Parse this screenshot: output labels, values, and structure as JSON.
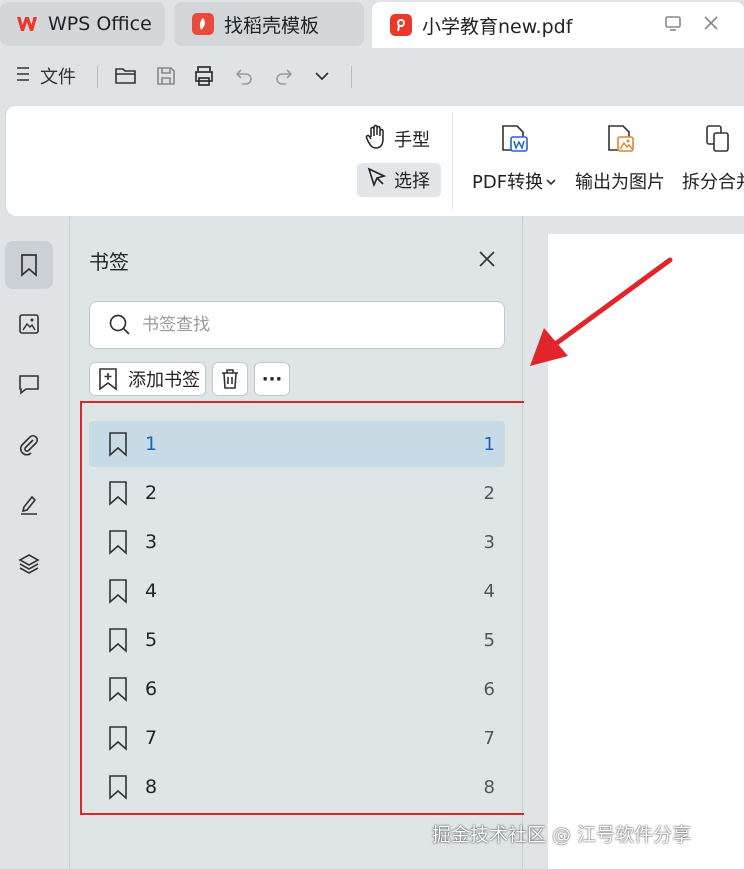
{
  "tabs": [
    {
      "label": "WPS Office"
    },
    {
      "label": "找稻壳模板"
    },
    {
      "label": "小学教育new.pdf"
    }
  ],
  "quickbar": {
    "menu_label": "文件"
  },
  "ribbon": {
    "hand_label": "手型",
    "select_label": "选择",
    "pdf_convert_label": "PDF转换",
    "export_image_label": "输出为图片",
    "split_merge_label": "拆分合并"
  },
  "panel": {
    "title": "书签",
    "search_placeholder": "书签查找",
    "add_bookmark_label": "添加书签",
    "more_label": "···",
    "bookmarks": [
      {
        "label": "1",
        "page": "1"
      },
      {
        "label": "2",
        "page": "2"
      },
      {
        "label": "3",
        "page": "3"
      },
      {
        "label": "4",
        "page": "4"
      },
      {
        "label": "5",
        "page": "5"
      },
      {
        "label": "6",
        "page": "6"
      },
      {
        "label": "7",
        "page": "7"
      },
      {
        "label": "8",
        "page": "8"
      }
    ]
  },
  "watermark": "掘金技术社区 @ 江号软件分享",
  "colors": {
    "accent_red": "#e0262b",
    "selected_row": "#c7dbe7",
    "selected_text": "#1a62c4"
  }
}
